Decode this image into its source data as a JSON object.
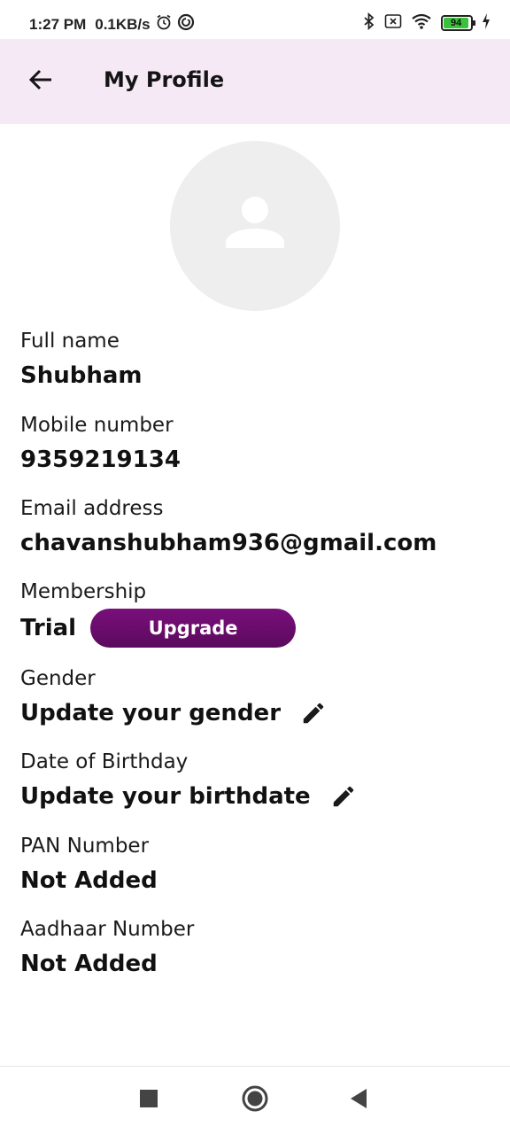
{
  "status_bar": {
    "time": "1:27 PM",
    "network_speed": "0.1KB/s",
    "battery_level": "94",
    "icons": [
      "alarm-icon",
      "sync-icon",
      "bluetooth-icon",
      "sim-off-icon",
      "wifi-icon",
      "battery-icon",
      "charging-icon"
    ]
  },
  "app_bar": {
    "title": "My Profile",
    "back_icon": "arrow-left-icon"
  },
  "avatar": {
    "icon": "person-icon"
  },
  "fields": {
    "full_name": {
      "label": "Full name",
      "value": "Shubham"
    },
    "mobile": {
      "label": "Mobile number",
      "value": "9359219134"
    },
    "email": {
      "label": "Email address",
      "value": "chavanshubham936@gmail.com"
    },
    "membership": {
      "label": "Membership",
      "value": "Trial",
      "upgrade_label": "Upgrade"
    },
    "gender": {
      "label": "Gender",
      "value": "Update your gender",
      "edit_icon": "pencil-icon"
    },
    "birthday": {
      "label": "Date of Birthday",
      "value": "Update your birthdate",
      "edit_icon": "pencil-icon"
    },
    "pan": {
      "label": "PAN Number",
      "value": "Not Added"
    },
    "aadhaar": {
      "label": "Aadhaar Number",
      "value": "Not Added"
    }
  },
  "nav_bar": {
    "icons": [
      "square-recents-icon",
      "circle-home-icon",
      "triangle-back-icon"
    ]
  },
  "colors": {
    "app_bar_bg": "#f6e9f6",
    "upgrade_button": "#6b0d6d",
    "avatar_bg": "#eeeeee"
  }
}
